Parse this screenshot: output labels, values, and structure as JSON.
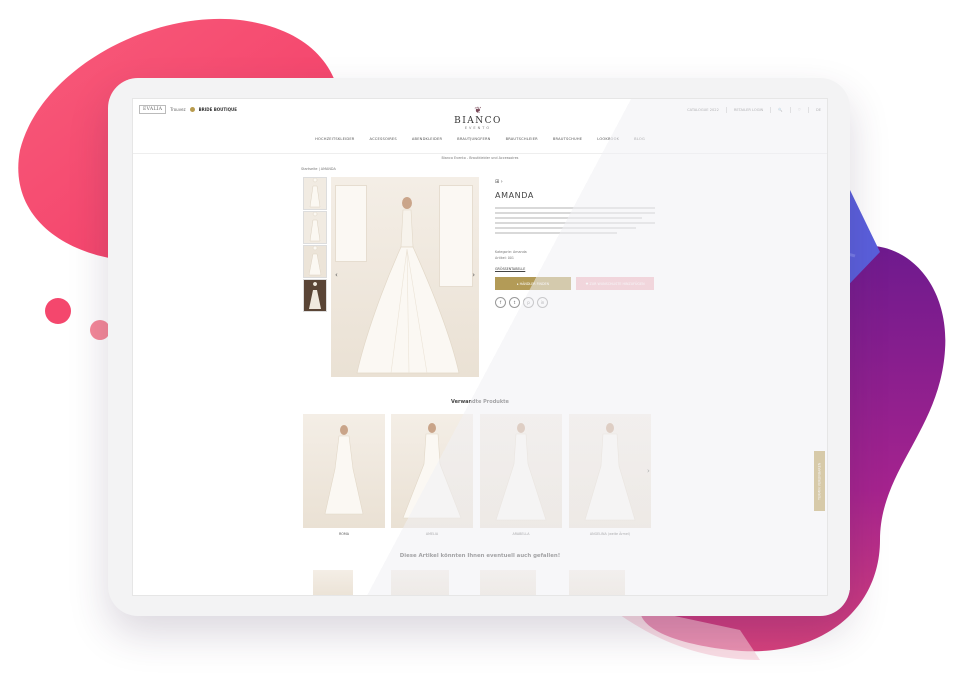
{
  "colors": {
    "accent_gold": "#b39b57",
    "wishlist_pink": "#f2b5bf",
    "blob_pink": "#f0416e",
    "blob_purple": "#8a22a0"
  },
  "header": {
    "partner_logo": "EVALIA",
    "partner_text": "Trouvez",
    "partner_badge": "BRIDE BOUTIQUE",
    "brand_name": "BIANCO",
    "brand_sub": "EVENTO",
    "util": [
      "CATALOGUE 2022",
      "RETAILER LOGIN",
      "🔍",
      "♡",
      "DE"
    ]
  },
  "nav": [
    "HOCHZEITSKLEIDER",
    "ACCESSOIRES",
    "ABENDKLEIDER",
    "BRAUTJUNGFERN",
    "BRAUTSCHLEIER",
    "BRAUTSCHUHE",
    "LOOKBOOK",
    "BLOG"
  ],
  "info_bar": "Bianco Evento - Brautkleider und Accessoires",
  "breadcrumb": "Startseite | AMANDA",
  "product": {
    "name": "AMANDA",
    "icons": "⊞  ›",
    "meta": [
      "Kategorie: Amanda",
      "Artikel: 001"
    ],
    "size_guide": "GRÖSSENTABELLE",
    "cta": "▸ HÄNDLER FINDEN",
    "wishlist": "♥ ZUR WUNSCHLISTE HINZUFÜGEN",
    "socials": [
      "f",
      "t",
      "p",
      "in"
    ]
  },
  "gallery": {
    "prev": "‹",
    "next": "›"
  },
  "related": {
    "title": "Verwandte Produkte",
    "items": [
      "ROMA",
      "AMELIA",
      "ARABELLA",
      "ANGELINA (weite Ärmel)"
    ],
    "next": "›"
  },
  "suggest": {
    "title": "Diese Artikel könnten Ihnen eventuell auch gefallen!"
  },
  "sidebar_tab": "TERMIN VEREINBAREN"
}
